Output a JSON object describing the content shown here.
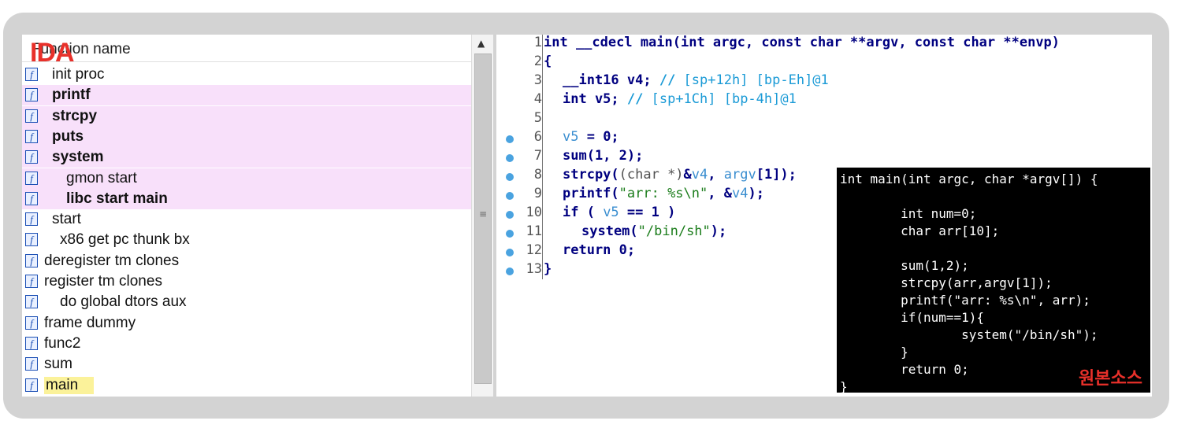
{
  "ida_label": "IDA",
  "function_list": {
    "header": "Function name",
    "items": [
      {
        "name": "init proc",
        "bold": false,
        "highlight": false
      },
      {
        "name": "printf",
        "bold": true,
        "highlight": true
      },
      {
        "name": "strcpy",
        "bold": true,
        "highlight": true
      },
      {
        "name": "puts",
        "bold": true,
        "highlight": true
      },
      {
        "name": "system",
        "bold": true,
        "highlight": true
      },
      {
        "name": "gmon start",
        "bold": false,
        "highlight": true
      },
      {
        "name": "libc start main",
        "bold": true,
        "highlight": true
      },
      {
        "name": "start",
        "bold": false,
        "highlight": false
      },
      {
        "name": "x86 get pc thunk bx",
        "bold": false,
        "highlight": false
      },
      {
        "name": "deregister tm clones",
        "bold": false,
        "highlight": false
      },
      {
        "name": "register tm clones",
        "bold": false,
        "highlight": false
      },
      {
        "name": "do global dtors aux",
        "bold": false,
        "highlight": false
      },
      {
        "name": "frame dummy",
        "bold": false,
        "highlight": false
      },
      {
        "name": "func2",
        "bold": false,
        "highlight": false
      },
      {
        "name": "sum",
        "bold": false,
        "highlight": false
      },
      {
        "name": "main",
        "bold": false,
        "highlight": false
      }
    ]
  },
  "pseudocode": {
    "line_numbers": [
      "1",
      "2",
      "3",
      "4",
      "5",
      "6",
      "7",
      "8",
      "9",
      "10",
      "11",
      "12",
      "13"
    ],
    "l1": "int __cdecl main(int argc, const char **argv, const char **envp)",
    "l2": "{",
    "l3_code": "__int16 v4; ",
    "l3_comment": "// [sp+12h] [bp-Eh]@1",
    "l4_code": "int v5; ",
    "l4_comment": "// [sp+1Ch] [bp-4h]@1",
    "l6_var": "v5",
    "l6_rest": " = 0;",
    "l7": "sum(1, 2);",
    "l8_a": "strcpy(",
    "l8_cast": "(char *)",
    "l8_b": "&",
    "l8_var": "v4",
    "l8_c": ", ",
    "l8_argv": "argv",
    "l8_d": "[1]);",
    "l9_a": "printf(",
    "l9_str": "\"arr: %s\\n\"",
    "l9_b": ", &",
    "l9_var": "v4",
    "l9_c": ");",
    "l10_a": "if ( ",
    "l10_var": "v5",
    "l10_b": " == 1 )",
    "l11_a": "system(",
    "l11_str": "\"/bin/sh\"",
    "l11_b": ");",
    "l12": "return 0;",
    "l13": "}"
  },
  "original_source": {
    "code": "int main(int argc, char *argv[]) {\n\n        int num=0;\n        char arr[10];\n\n        sum(1,2);\n        strcpy(arr,argv[1]);\n        printf(\"arr: %s\\n\", arr);\n        if(num==1){\n                system(\"/bin/sh\");\n        }\n        return 0;\n}",
    "label": "원본소스"
  },
  "colors": {
    "accent_red": "#e8302a",
    "highlight_pink": "#f8e0fa",
    "highlight_yellow": "#fbf29a",
    "code_keyword": "#000080",
    "code_comment": "#1a9ad6",
    "code_string": "#1c7d1c",
    "breakpoint_dot": "#4aa3e0"
  },
  "icons": {
    "function": "function-icon",
    "scroll_up": "arrow-up-icon",
    "scroll_grip": "grip-icon"
  }
}
